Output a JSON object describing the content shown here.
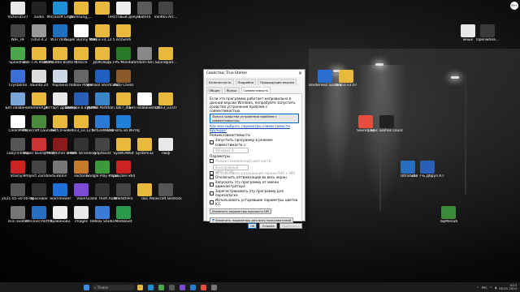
{
  "desktop_icons": [
    {
      "label": "Victoria537",
      "color": "#e8e8e8"
    },
    {
      "label": "audio",
      "color": "#222"
    },
    {
      "label": "Microsoft Edge",
      "color": "#1e90d6"
    },
    {
      "label": "Samsung_...",
      "color": "#e9b93e"
    },
    {
      "label": "",
      "color": "#e9b93e"
    },
    {
      "label": "Текстовый документ",
      "color": "#eeeeee"
    },
    {
      "label": "Satera",
      "color": "#5a5a5a"
    },
    {
      "label": "xSnKkv.Arc...",
      "color": "#444"
    },
    {
      "label": "WiFi_HF",
      "color": "#444"
    },
    {
      "label": "rufus-4.2",
      "color": "#999"
    },
    {
      "label": "W37783l...",
      "color": "#1f6fbf"
    },
    {
      "label": "Super Bunny Man v1.0.1...",
      "color": "#ffffff"
    },
    {
      "label": "Odin3 v3.12.5",
      "color": "#e9b93e"
    },
    {
      "label": "ocsSen6",
      "color": "#e9b93e"
    },
    {
      "label": "мнык",
      "color": "#e8e8e8"
    },
    {
      "label": "Openwhea...",
      "color": "#3a3a3a"
    },
    {
      "label": "SpeedFan",
      "color": "#4aa84a"
    },
    {
      "label": "Hall-7-Ai Mobi.in...",
      "color": "#e9b93e"
    },
    {
      "label": "BWMFR60 BOIIOTMO",
      "color": "#e9b93e"
    },
    {
      "label": "Brecce",
      "color": "#e9b93e"
    },
    {
      "label": "ДОКОВДЬ",
      "color": "#e9b93e"
    },
    {
      "label": "FPS Monitor",
      "color": "#2a7a2a"
    },
    {
      "label": "random-ten...",
      "color": "#888"
    },
    {
      "label": "Soundpad...",
      "color": "#e9b93e"
    },
    {
      "label": "Crystalmo",
      "color": "#3b6fd6"
    },
    {
      "label": "obunto-24",
      "color": "#dddddd"
    },
    {
      "label": "Корзина",
      "color": "#ccd8e8"
    },
    {
      "label": "Roblox Player",
      "color": "#666"
    },
    {
      "label": "WinTool Shortcuts",
      "color": "#1e5fbf"
    },
    {
      "label": "Auto Chess",
      "color": "#8b5a2b"
    },
    {
      "label": "Borderless Gaming",
      "color": "#2a6fd0"
    },
    {
      "label": "Odin3 v3.07",
      "color": "#e9b93e"
    },
    {
      "label": "Без названия",
      "color": "#7aa6d8"
    },
    {
      "label": "ShareX_d",
      "color": "#e9b93e"
    },
    {
      "label": "рестарт драйвера",
      "color": "#e8e8e8"
    },
    {
      "label": "Шаблон в курсовой",
      "color": "#2b5eb5"
    },
    {
      "label": "AOMEI Partition...",
      "color": "#3a86c8"
    },
    {
      "label": "fall7_dla",
      "color": "#e9b93e"
    },
    {
      "label": "Без названия (1)",
      "color": "#ffffff"
    },
    {
      "label": "Odin3_v3.07",
      "color": "#e9b93e"
    },
    {
      "label": "CleanMem",
      "color": "#ffffff"
    },
    {
      "label": "Minecraft Launcher",
      "color": "#4a8a3a"
    },
    {
      "label": "net5.0-win",
      "color": "#e9b93e"
    },
    {
      "label": "Odin3_v3.12.5",
      "color": "#e9b93e"
    },
    {
      "label": "VirtualWorld",
      "color": "#2b7bd6"
    },
    {
      "label": "Скачать из Интернета",
      "color": "#1e7fd6"
    },
    {
      "label": "Soundpad",
      "color": "#e74c3c"
    },
    {
      "label": "Epic Games Launcher",
      "color": "#222"
    },
    {
      "label": "LabyrinthMo",
      "color": "#555"
    },
    {
      "label": "Super Bunny Man",
      "color": "#cc3333"
    },
    {
      "label": "The Witcher 3 Wild Hunt",
      "color": "#8b1a1a"
    },
    {
      "label": "Death Stranding",
      "color": "#333"
    },
    {
      "label": "hdpAssist",
      "color": "#444"
    },
    {
      "label": "SysWOW64",
      "color": "#e9b93e"
    },
    {
      "label": "System32",
      "color": "#e9b93e"
    },
    {
      "label": "пюф",
      "color": "#e8e8e8"
    },
    {
      "label": "Stashylo",
      "color": "#cc2222"
    },
    {
      "label": "Project Zomboid",
      "color": "#444"
    },
    {
      "label": "x360ce",
      "color": "#777"
    },
    {
      "label": "Factorio",
      "color": "#c47a2a"
    },
    {
      "label": "Google Play Игры (бета)",
      "color": "#3a9a3a"
    },
    {
      "label": "unlocker-x64",
      "color": "#cc2222"
    },
    {
      "label": "UltraISO",
      "color": "#2a6fbf"
    },
    {
      "label": "Зай 7-Б Дбруя А.С",
      "color": "#2b5eb5"
    },
    {
      "label": "2021-05-30 00-00-05",
      "color": "#555"
    },
    {
      "label": "Spacewar",
      "color": "#333"
    },
    {
      "label": "TeamViewer",
      "color": "#1e6fd6"
    },
    {
      "label": "Viber",
      "color": "#7b4bd6"
    },
    {
      "label": "Grand Theft Auto San...",
      "color": "#333"
    },
    {
      "label": "MSPathPro",
      "color": "#444"
    },
    {
      "label": "das",
      "color": "#e9b93e"
    },
    {
      "label": "Minecraft Bedrock (...",
      "color": "#555"
    },
    {
      "label": "skin avatar",
      "color": "#777"
    },
    {
      "label": "WinTool Portfill",
      "color": "#2a6fbf"
    },
    {
      "label": "прованой2",
      "color": "#eeeeee"
    },
    {
      "label": "images",
      "color": "#e8e8e8"
    },
    {
      "label": "Roblox Studio",
      "color": "#3a7bd6"
    },
    {
      "label": "MediaGet",
      "color": "#2a9a4a"
    },
    {
      "label": "TapMenu6",
      "color": "#3a8a3a"
    }
  ],
  "dialog": {
    "title": "Свойства: True Stalker",
    "tabs": [
      "Безопасность",
      "Подробно",
      "Предыдущие версии",
      "Общие",
      "Ярлык",
      "Совместимость"
    ],
    "intro": "Если эта программа работает неправильно в данной версии Windows, попробуйте запустить средство устранения проблем с совместимостью.",
    "troubleshoot_button": "Запуск средства устранения проблем с совместимостью",
    "manual_link": "Как мне выбрать параметры совместимости вручную?",
    "compat_mode_header": "Режим совместимости",
    "compat_mode_check": "Запустить программу в режиме совместимости с:",
    "compat_mode_value": "Windows 8",
    "params_header": "Параметры",
    "reduced_color": "Режим пониженной цветности",
    "color_value": "8-разрядный цвет (256)",
    "res_640": "Использовать разрешение экрана 640 x 480",
    "fullscreen_opt": "Отключить оптимизацию во весь экран",
    "run_admin": "Запускать эту программу от имени администратора",
    "register_restart": "Зарегистрировать эту программу для перезапуска",
    "icc": "Использовать устаревшие параметры цветов ICC",
    "dpi_button": "Изменить параметры высокого DPI",
    "all_users_button": "Изменить параметры для всех пользователей",
    "ok": "OK",
    "cancel": "Отмена",
    "apply": "Применить"
  },
  "taskbar": {
    "search_placeholder": "Поиск",
    "lang": "РУС",
    "time": "0:23",
    "date": "05.01.2024"
  },
  "corner_badge": "99+"
}
